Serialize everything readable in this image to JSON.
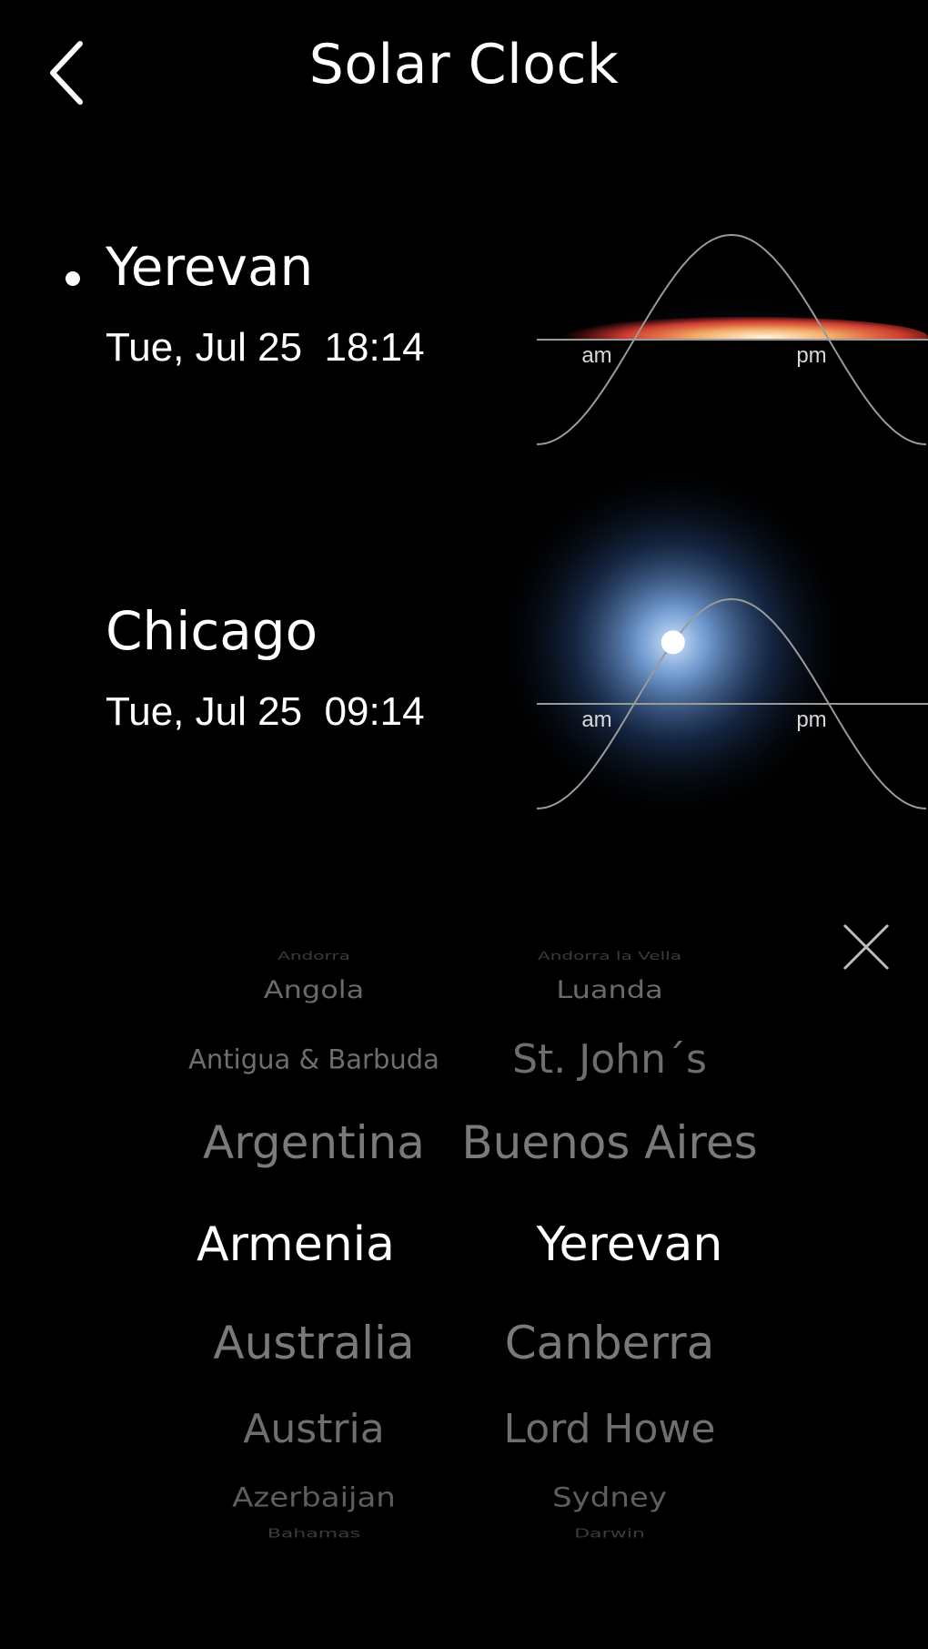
{
  "header": {
    "title": "Solar Clock",
    "back_icon": "chevron-left-icon"
  },
  "cities": [
    {
      "name": "Yerevan",
      "datetime": "Tue, Jul 25  18:14",
      "selected": true,
      "graph": {
        "am_label": "am",
        "pm_label": "pm",
        "sun_time_fraction": 0.73,
        "sun_visible": false
      }
    },
    {
      "name": "Chicago",
      "datetime": "Tue, Jul 25  09:14",
      "selected": false,
      "graph": {
        "am_label": "am",
        "pm_label": "pm",
        "sun_time_fraction": 0.35,
        "sun_visible": true
      }
    }
  ],
  "picker": {
    "close_icon": "close-icon",
    "rows": [
      {
        "country": "Andorra",
        "capital": "Andorra la Vella"
      },
      {
        "country": "Angola",
        "capital": "Luanda"
      },
      {
        "country": "Antigua & Barbuda",
        "capital": "St. John´s"
      },
      {
        "country": "Argentina",
        "capital": "Buenos Aires"
      },
      {
        "country": "Armenia",
        "capital": "Yerevan"
      },
      {
        "country": "Australia",
        "capital": "Canberra"
      },
      {
        "country": "Austria",
        "capital": "Lord Howe"
      },
      {
        "country": "Azerbaijan",
        "capital": "Sydney"
      },
      {
        "country": "Bahamas",
        "capital": "Darwin"
      }
    ],
    "selected_index": 4
  },
  "colors": {
    "background": "#000000",
    "text": "#ffffff",
    "curve": "#9a9a9a",
    "sunrise_glow": "#ff6a3c",
    "day_glow": "#6fa0e6"
  }
}
